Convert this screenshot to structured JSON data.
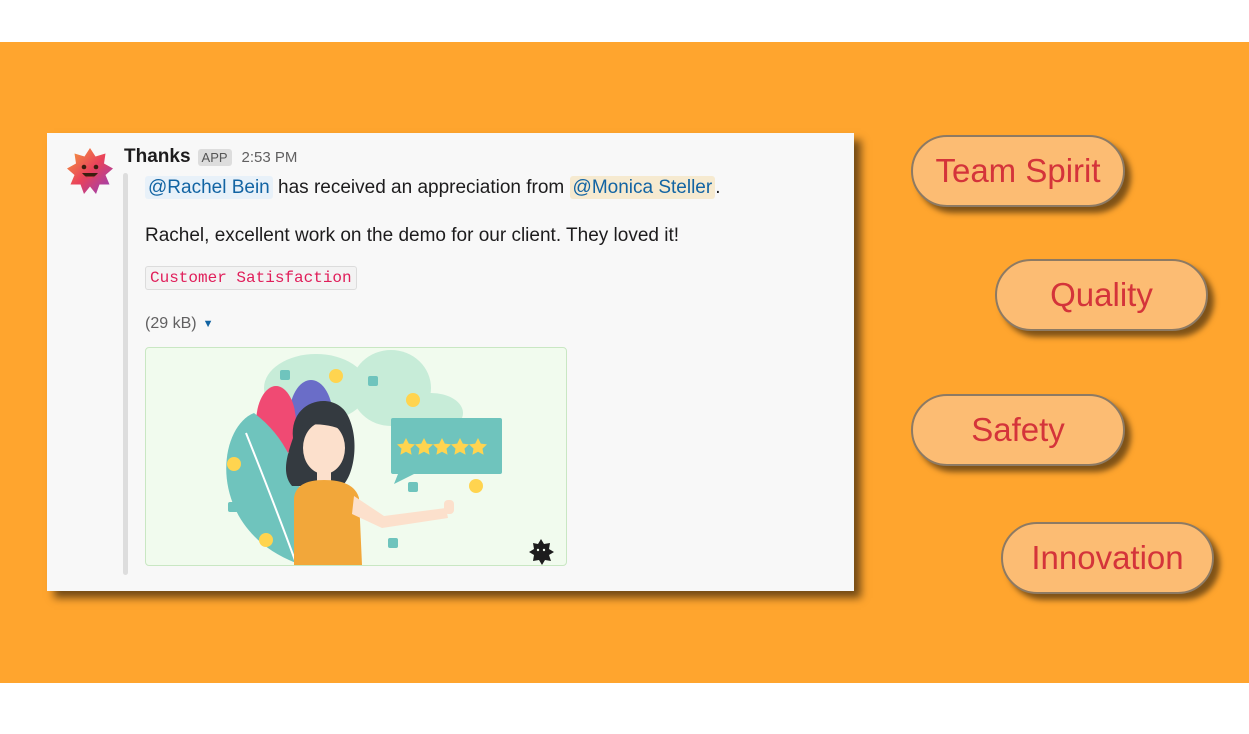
{
  "message": {
    "sender": "Thanks",
    "badge": "APP",
    "time": "2:53 PM",
    "recipient_mention": "@Rachel Bein",
    "middle_text": " has received an appreciation from ",
    "sender_mention": "@Monica Steller",
    "end_punct": ".",
    "body": "Rachel, excellent work on the demo for our client. They loved it!",
    "value_tag": "Customer Satisfaction",
    "attachment": {
      "size": "(29 kB)"
    }
  },
  "values": [
    {
      "label": "Team Spirit"
    },
    {
      "label": "Quality"
    },
    {
      "label": "Safety"
    },
    {
      "label": "Innovation"
    }
  ],
  "colors": {
    "background_band": "#FFA52E",
    "pill_fill": "#FCBC73",
    "pill_text": "#D4343A",
    "mention_text": "#1264a3",
    "tag_text": "#e01e5a"
  },
  "icons": {
    "avatar": "smiling-star-icon",
    "caret": "caret-down-icon",
    "corner": "bot-badge-icon"
  }
}
